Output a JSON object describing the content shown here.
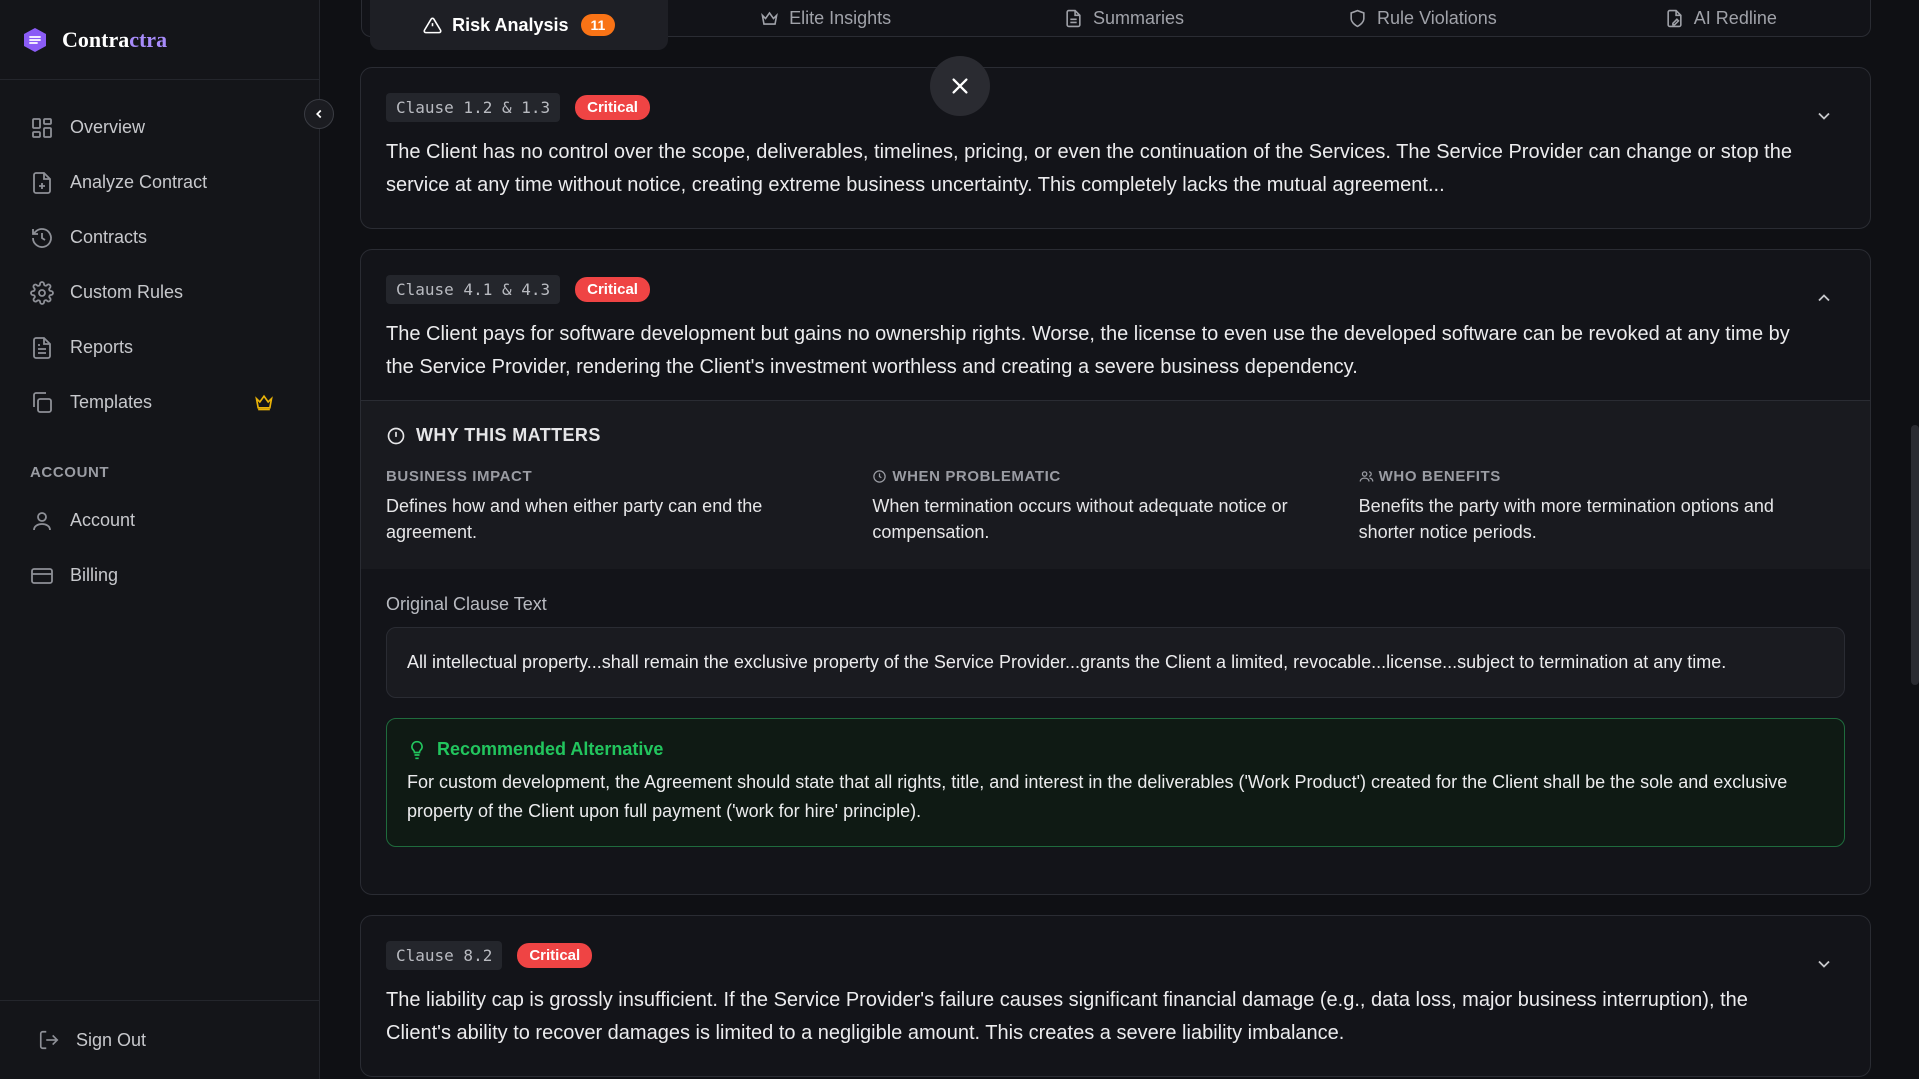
{
  "brand": {
    "name_main": "Contra",
    "name_accent": "ctra",
    "accent_color": "#a78bfa"
  },
  "sidebar": {
    "items": [
      {
        "label": "Overview",
        "icon": "grid-icon"
      },
      {
        "label": "Analyze Contract",
        "icon": "file-plus-icon"
      },
      {
        "label": "Contracts",
        "icon": "history-icon"
      },
      {
        "label": "Custom Rules",
        "icon": "gear-icon"
      },
      {
        "label": "Reports",
        "icon": "report-icon"
      },
      {
        "label": "Templates",
        "icon": "copy-icon",
        "badge_icon": "crown-icon"
      }
    ],
    "account_section_label": "ACCOUNT",
    "account_items": [
      {
        "label": "Account",
        "icon": "user-icon"
      },
      {
        "label": "Billing",
        "icon": "credit-card-icon"
      }
    ],
    "sign_out": "Sign Out"
  },
  "tabs": [
    {
      "label": "Risk Analysis",
      "icon": "warning-icon",
      "badge": "11",
      "active": true
    },
    {
      "label": "Elite Insights",
      "icon": "crown-icon"
    },
    {
      "label": "Summaries",
      "icon": "document-icon"
    },
    {
      "label": "Rule Violations",
      "icon": "shield-icon"
    },
    {
      "label": "AI Redline",
      "icon": "file-edit-icon"
    }
  ],
  "colors": {
    "critical": "#ef4444",
    "badge_orange": "#f97316",
    "recommended_green": "#22c55e"
  },
  "cards": [
    {
      "clause": "Clause 1.2 & 1.3",
      "severity": "Critical",
      "text": "The Client has no control over the scope, deliverables, timelines, pricing, or even the continuation of the Services. The Service Provider can change or stop the service at any time without notice, creating extreme business uncertainty. This completely lacks the mutual agreement..."
    },
    {
      "clause": "Clause 4.1 & 4.3",
      "severity": "Critical",
      "text": "The Client pays for software development but gains no ownership rights. Worse, the license to even use the developed software can be revoked at any time by the Service Provider, rendering the Client's investment worthless and creating a severe business dependency.",
      "why": {
        "title": "WHY THIS MATTERS",
        "business_impact_label": "BUSINESS IMPACT",
        "business_impact": "Defines how and when either party can end the agreement.",
        "when_problematic_label": "WHEN PROBLEMATIC",
        "when_problematic": "When termination occurs without adequate notice or compensation.",
        "who_benefits_label": "WHO BENEFITS",
        "who_benefits": "Benefits the party with more termination options and shorter notice periods."
      },
      "original_label": "Original Clause Text",
      "original_text": "All intellectual property...shall remain the exclusive property of the Service Provider...grants the Client a limited, revocable...license...subject to termination at any time.",
      "recommended_title": "Recommended Alternative",
      "recommended_text": "For custom development, the Agreement should state that all rights, title, and interest in the deliverables ('Work Product') created for the Client shall be the sole and exclusive property of the Client upon full payment ('work for hire' principle)."
    },
    {
      "clause": "Clause 8.2",
      "severity": "Critical",
      "text": "The liability cap is grossly insufficient. If the Service Provider's failure causes significant financial damage (e.g., data loss, major business interruption), the Client's ability to recover damages is limited to a negligible amount. This creates a severe liability imbalance."
    }
  ]
}
